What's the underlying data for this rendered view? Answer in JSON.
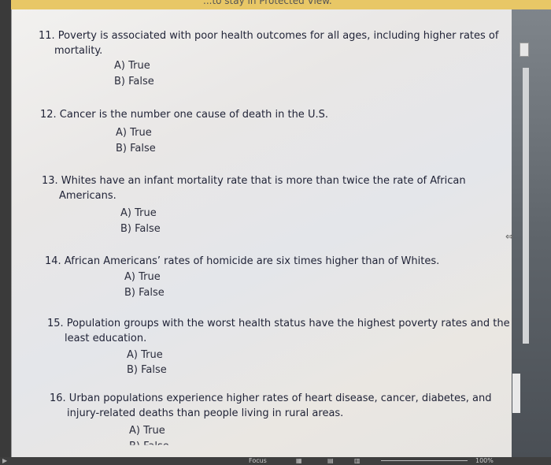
{
  "banner": {
    "text": "...to stay in Protected View."
  },
  "questions": [
    {
      "text": "11. Poverty is associated with poor health outcomes for all ages, including higher rates of",
      "cont": "mortality.",
      "a": "A)  True",
      "b": "B)  False"
    },
    {
      "text": "12. Cancer is the number one cause of death in the U.S.",
      "cont": "",
      "a": "A)  True",
      "b": "B)  False"
    },
    {
      "text": "13. Whites have an infant mortality rate that is more than twice the rate of African",
      "cont": "Americans.",
      "a": "A)  True",
      "b": "B)  False"
    },
    {
      "text": "14. African Americans’ rates of homicide are six times higher than of Whites.",
      "cont": "",
      "a": "A)  True",
      "b": "B)  False"
    },
    {
      "text": "15. Population groups with the worst health status have the highest poverty rates and the",
      "cont": "least education.",
      "a": "A)  True",
      "b": "B)  False"
    },
    {
      "text": "16. Urban populations experience higher rates of heart disease, cancer, diabetes, and",
      "cont": "injury-related deaths than people living in rural areas.",
      "a": "A)  True",
      "b": "B)  False"
    }
  ],
  "status": {
    "focus": "Focus",
    "zoom": "100%"
  },
  "icons": {
    "resize": "resize-arrows-icon",
    "play": "play-icon",
    "layout1": "read-mode-icon",
    "layout2": "print-layout-icon",
    "layout3": "web-layout-icon"
  }
}
